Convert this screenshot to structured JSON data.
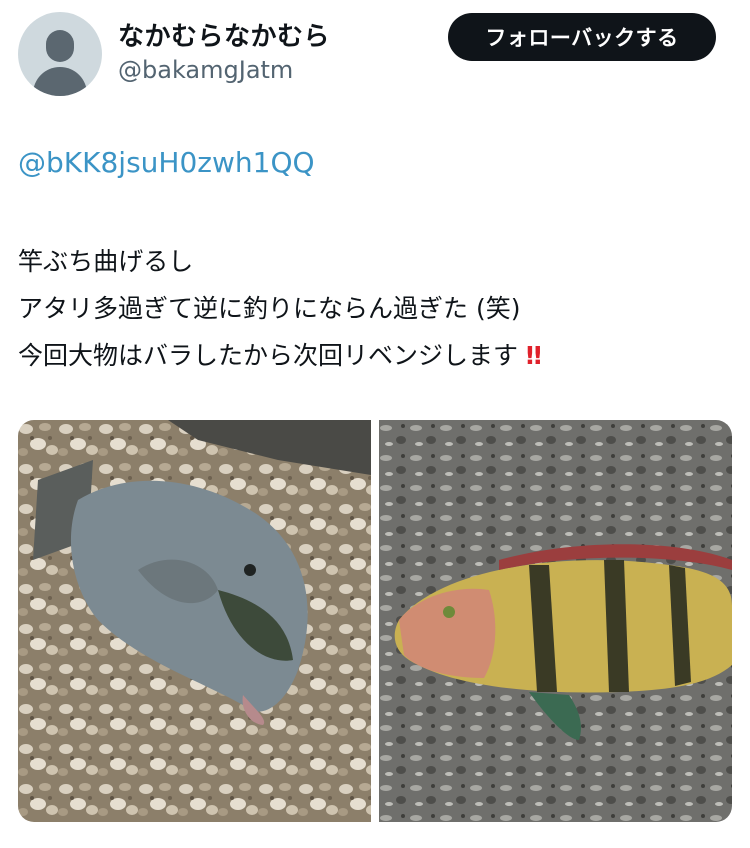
{
  "user": {
    "display_name": "なかむらなかむら",
    "handle": "@bakamgJatm",
    "avatar_icon": "default-avatar-icon"
  },
  "follow_button": {
    "label": "フォローバックする"
  },
  "tweet": {
    "mention": "@bKK8jsuH0zwh1QQ",
    "lines": [
      "竿ぶち曲げるし",
      "アタリ多過ぎて逆に釣りにならん過ぎた (笑)",
      "今回大物はバラしたから次回リベンジします"
    ],
    "emoji": "‼"
  },
  "colors": {
    "link": "#3b94c6",
    "button_bg": "#0f1419",
    "emoji": "#e0212b"
  }
}
